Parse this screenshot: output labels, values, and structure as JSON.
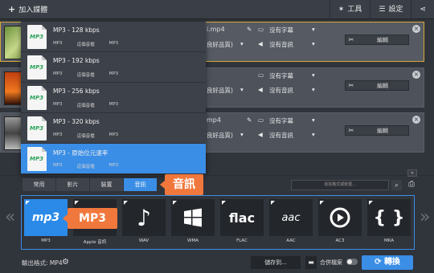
{
  "toolbar": {
    "add_media": "加入媒體",
    "tools": "工具",
    "settings": "設定"
  },
  "files": [
    {
      "name_frag": "i.mp4",
      "subtitle": "沒有字幕",
      "audio_frag": "良好品質)",
      "audio": "沒有音訊",
      "edit": "編輯"
    },
    {
      "name_frag": "mp4",
      "subtitle": "沒有字幕",
      "audio_frag": "良好品質)",
      "audio": "沒有音訊",
      "edit": "編輯"
    },
    {
      "name_frag": "mp4",
      "subtitle": "沒有字幕",
      "audio_frag": "良好品質)",
      "audio": "沒有音訊",
      "edit": "編輯"
    }
  ],
  "menu": {
    "items": [
      {
        "title": "MP3 - 128 kbps",
        "m1": "MP3",
        "m2": "這個音檔",
        "m3": "MP3"
      },
      {
        "title": "MP3 - 192 kbps",
        "m1": "MP3",
        "m2": "這個音檔",
        "m3": "MP3"
      },
      {
        "title": "MP3 - 256 kbps",
        "m1": "MP3",
        "m2": "這個音檔",
        "m3": "MP3"
      },
      {
        "title": "MP3 - 320 kbps",
        "m1": "MP3",
        "m2": "這個音檔",
        "m3": "MP3"
      },
      {
        "title": "MP3 - 原始位元速率",
        "m1": "MP3",
        "m2": "這個音檔",
        "m3": "MP3"
      }
    ]
  },
  "tabs": [
    "常用",
    "影片",
    "裝置",
    "音訊"
  ],
  "callouts": {
    "tab": "音訊",
    "format": "MP3"
  },
  "search": {
    "placeholder": "尋找格式或裝置..."
  },
  "formats": [
    {
      "label": "MP3",
      "icon": "mp3-icon"
    },
    {
      "label": "Apple 音訊",
      "icon": "apple-music-icon"
    },
    {
      "label": "WAV",
      "icon": "music-note-icon"
    },
    {
      "label": "WMA",
      "icon": "windows-icon"
    },
    {
      "label": "FLAC",
      "icon": "flac-icon"
    },
    {
      "label": "AAC",
      "icon": "aac-icon"
    },
    {
      "label": "AC3",
      "icon": "play-circle-icon"
    },
    {
      "label": "MKA",
      "icon": "mka-icon"
    }
  ],
  "tile_text": {
    "flac": "flac",
    "aac": "aac",
    "mp3": "mp3"
  },
  "footer": {
    "output_format": "輸出格式: MP4",
    "save_to": "儲存到...",
    "merge": "合併檔案",
    "convert": "轉換"
  },
  "colors": {
    "accent": "#3a8ee6",
    "callout": "#f0783c",
    "selected_border": "#d4a93a"
  }
}
